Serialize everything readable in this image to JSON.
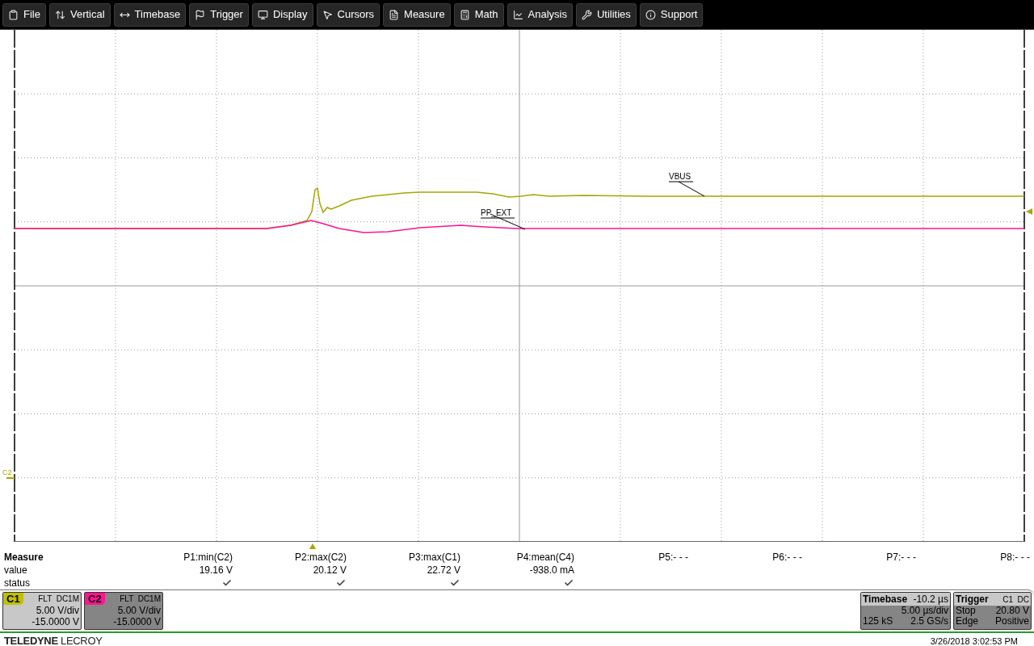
{
  "menu": [
    "File",
    "Vertical",
    "Timebase",
    "Trigger",
    "Display",
    "Cursors",
    "Measure",
    "Math",
    "Analysis",
    "Utilities",
    "Support"
  ],
  "traces": [
    {
      "label": "VBUS",
      "color": "#a6a600"
    },
    {
      "label": "PP_EXT",
      "color": "#ff1493"
    }
  ],
  "grid_marker": {
    "label": "C2"
  },
  "measure": {
    "title": "Measure",
    "row_labels": [
      "value",
      "status"
    ],
    "params": [
      {
        "name": "P1:min(C2)",
        "value": "19.16 V",
        "ok": true
      },
      {
        "name": "P2:max(C2)",
        "value": "20.12 V",
        "ok": true
      },
      {
        "name": "P3:max(C1)",
        "value": "22.72 V",
        "ok": true
      },
      {
        "name": "P4:mean(C4)",
        "value": "-938.0 mA",
        "ok": true
      },
      {
        "name": "P5:- - -"
      },
      {
        "name": "P6:- - -"
      },
      {
        "name": "P7:- - -"
      },
      {
        "name": "P8:- - -"
      }
    ]
  },
  "channels": [
    {
      "name": "C1",
      "color": "#c0c000",
      "selected": true,
      "coupling": "FLT  DC1M",
      "scale": "5.00 V/div",
      "offset": "-15.0000 V"
    },
    {
      "name": "C2",
      "color": "#ff1493",
      "selected": false,
      "coupling": "FLT  DC1M",
      "scale": "5.00 V/div",
      "offset": "-15.0000 V"
    }
  ],
  "timebase": {
    "title": "Timebase",
    "delay": "-10.2 µs",
    "scale": "5.00 µs/div",
    "samples": "125 kS",
    "rate": "2.5 GS/s"
  },
  "trigger": {
    "title": "Trigger",
    "source": "C1  DC",
    "mode": "Stop",
    "level": "20.80 V",
    "type": "Edge",
    "slope": "Positive"
  },
  "brand": {
    "bold": "TELEDYNE",
    "light": "LECROY"
  },
  "timestamp": "3/26/2018 3:02:53 PM"
}
